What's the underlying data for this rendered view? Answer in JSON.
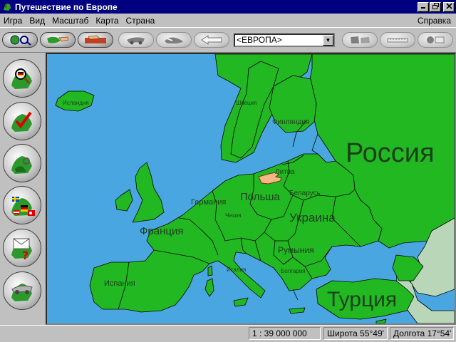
{
  "window": {
    "title": "Путешествие по Европе"
  },
  "menu": {
    "items": [
      "Игра",
      "Вид",
      "Масштаб",
      "Карта",
      "Страна"
    ],
    "help": "Справка"
  },
  "toolbar": {
    "region_select": "<ЕВРОПА>"
  },
  "map": {
    "labels": {
      "russia": "Россия",
      "turkey": "Турция",
      "ukraine": "Украина",
      "poland": "Польша",
      "france": "Франция",
      "spain": "Испания",
      "germany": "Германия",
      "romania": "Румыния",
      "belarus": "Беларусь",
      "lithuania": "Литва",
      "finland": "Финляндия",
      "sweden": "Швеция",
      "iceland": "Исландия",
      "czechia": "Чехия",
      "bulgaria": "Болгария",
      "italy": "Италия"
    },
    "colors": {
      "sea": "#4aa6e0",
      "land": "#22b822",
      "border": "#000000",
      "outside": "#b9d6b9"
    }
  },
  "status": {
    "scale": "1 : 39 000 000",
    "latitude": "Широта  55°49'",
    "longitude": "Долгота  17°54'"
  }
}
